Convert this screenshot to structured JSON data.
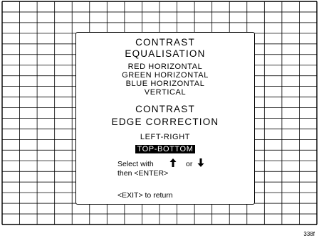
{
  "menu": {
    "header_1_line_1": "CONTRAST",
    "header_1_line_2": "EQUALISATION",
    "items_1": [
      "RED HORIZONTAL",
      "GREEN HORIZONTAL",
      "BLUE HORIZONTAL",
      "VERTICAL"
    ],
    "header_2_line_1": "CONTRAST",
    "header_2_line_2": "EDGE CORRECTION",
    "items_2": [
      "LEFT-RIGHT",
      "TOP-BOTTOM"
    ],
    "selected_item": "TOP-BOTTOM",
    "instructions": {
      "select_with": "Select with",
      "or": "or",
      "then_enter": "then <ENTER>",
      "exit": "<EXIT> to return"
    },
    "icons": {
      "up": "arrow-up-icon",
      "down": "arrow-down-icon"
    }
  },
  "figure_id": "338f"
}
